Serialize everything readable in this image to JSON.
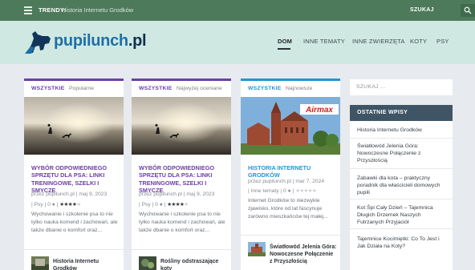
{
  "topbar": {
    "trendy_label": "TRENDY:",
    "trendy_text": "Historia Internetu Grodków",
    "search_label": "SZUKAJ"
  },
  "header": {
    "logo_main": "pupilunch",
    "logo_tld": ".pl",
    "nav": [
      "DOM",
      "INNE TEMATY",
      "INNE ZWIERZĘTA",
      "KOTY",
      "PSY"
    ]
  },
  "colors": {
    "topbar": "#4d7a5a",
    "header": "#cfe9e2",
    "purple": "#6b3fa8",
    "blue": "#2196d6"
  },
  "columns": [
    {
      "category": "WSZYSTKIE",
      "tab": "Popularne",
      "title": "WYBÓR ODPOWIEDNIEGO SPRZĘTU DLA PSA: LINKI TRENINGOWE, SZELKI I SMYCZE",
      "meta1": "przez pupilunch.pl | maj 9, 2023",
      "meta2_prefix": "| Psy | 0",
      "rating": 4.5,
      "excerpt": "Wychowanie i szkolenie psa to nie tylko nauka komend i zachowań, ale także dbanie o komfort oraz...",
      "next_title": "Historia Internetu Grodków"
    },
    {
      "category": "WSZYSTKIE",
      "tab": "Najwyżej oceniane",
      "title": "WYBÓR ODPOWIEDNIEGO SPRZĘTU DLA PSA: LINKI TRENINGOWE, SZELKI I SMYCZE",
      "meta1": "przez pupilunch.pl | maj 9, 2023",
      "meta2_prefix": "| Psy | 0",
      "rating": 4.5,
      "excerpt": "Wychowanie i szkolenie psa to nie tylko nauka komend i zachowań, ale także dbanie o komfort oraz...",
      "next_title": "Rośliny odstraszające koty"
    },
    {
      "category": "WSZYSTKIE",
      "tab": "Najnowsze",
      "title": "HISTORIA INTERNETU GRODKÓW",
      "meta1": "przez pupilunch.pl | mar 7, 2024",
      "meta2_prefix": "| Inne tematy | 0",
      "rating": 0,
      "excerpt": "Internet Grodków to niezwykle zjawisko, które od lat fascynuje zarówno mieszkańców tej małej...",
      "next_title": "Światłowód Jelenia Góra: Nowoczesne Połączenie z Przyszłością",
      "image_banner": "Airmax"
    }
  ],
  "sidebar": {
    "search_placeholder": "SZUKAJ ...",
    "widget_title": "OSTATNIE WPISY",
    "recent": [
      "Historia Internetu Grodków",
      "Światłowód Jelenia Góra: Nowoczesne Połączenie z Przyszłością",
      "Zabawki dla kota – praktyczny poradnik dla właścicieli domowych pupili",
      "Kot Śpi Cały Dzień – Tajemnica Długich Drzemek Naszych Futrzanych Przyjaciół",
      "Tajemnice Kocimiętki: Co To Jest i Jak Działa na Koty?"
    ]
  }
}
